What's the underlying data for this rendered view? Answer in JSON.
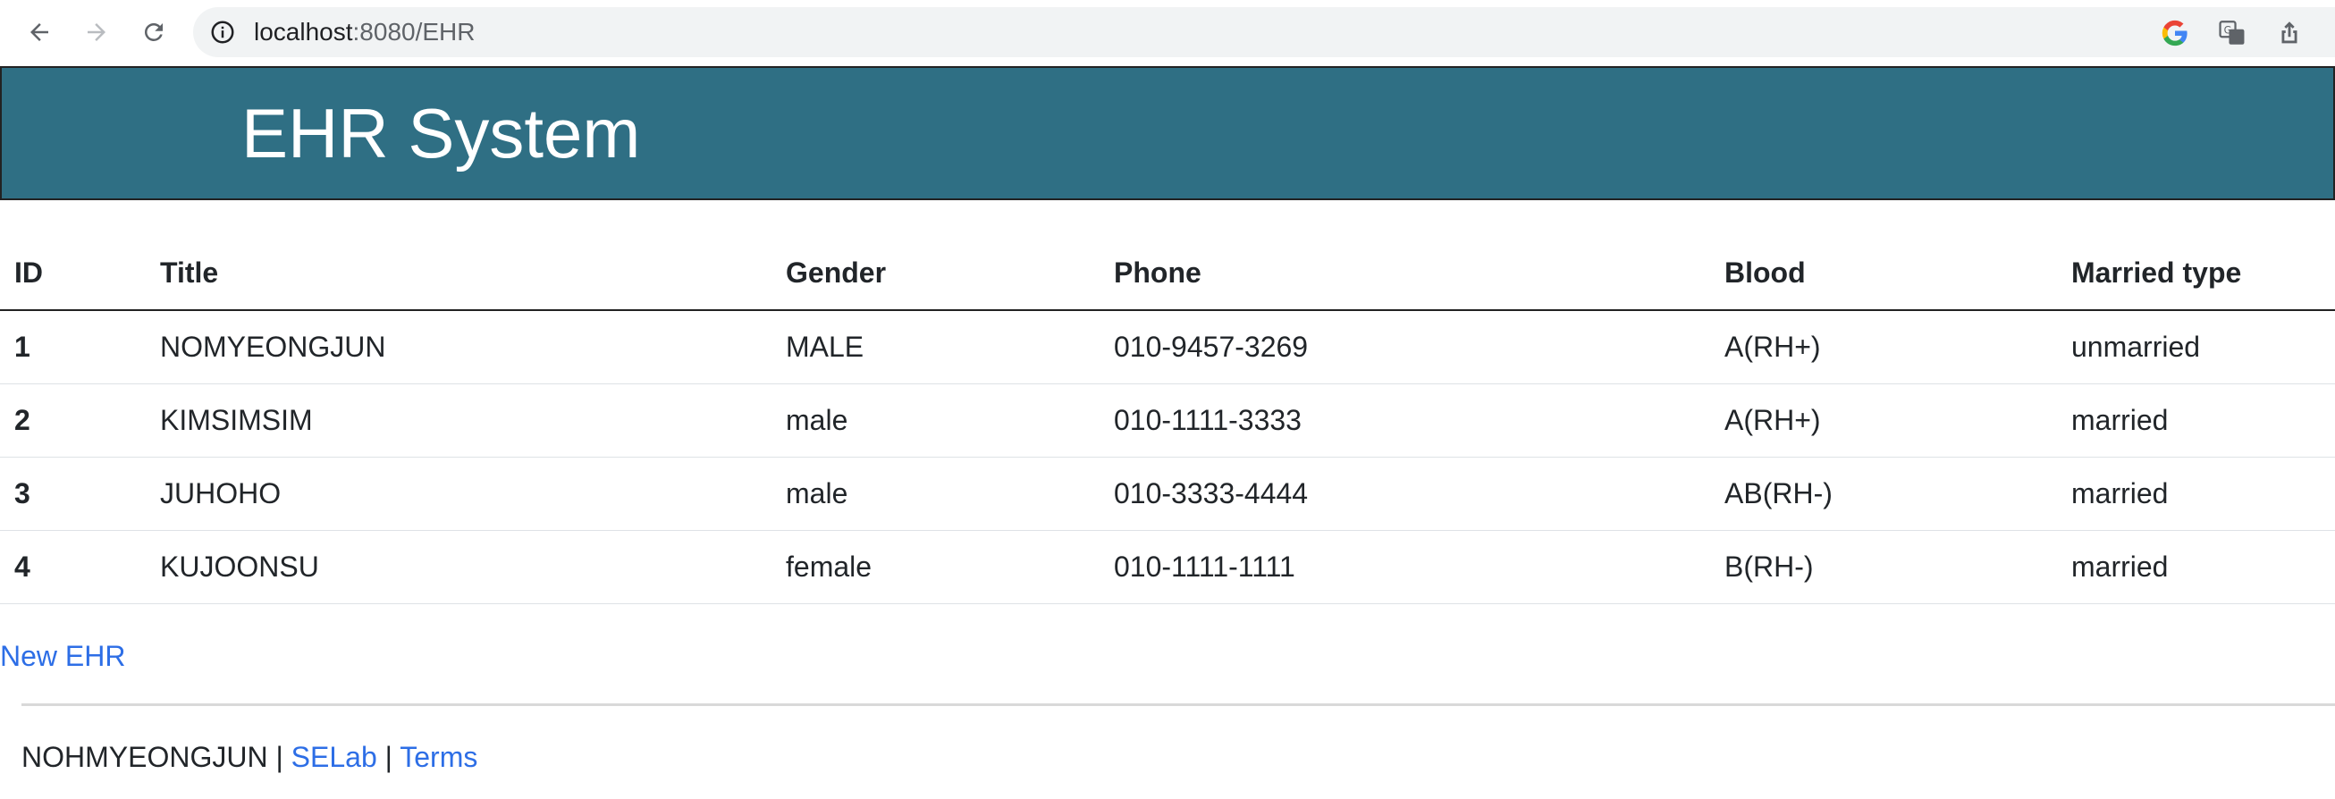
{
  "browser": {
    "url_host": "localhost",
    "url_path": ":8080/EHR"
  },
  "header": {
    "title": "EHR System"
  },
  "table": {
    "columns": [
      "ID",
      "Title",
      "Gender",
      "Phone",
      "Blood",
      "Married type"
    ],
    "rows": [
      {
        "id": "1",
        "title": "NOMYEONGJUN",
        "gender": "MALE",
        "phone": "010-9457-3269",
        "blood": "A(RH+)",
        "married": "unmarried"
      },
      {
        "id": "2",
        "title": "KIMSIMSIM",
        "gender": "male",
        "phone": "010-1111-3333",
        "blood": "A(RH+)",
        "married": "married"
      },
      {
        "id": "3",
        "title": "JUHOHO",
        "gender": "male",
        "phone": "010-3333-4444",
        "blood": "AB(RH-)",
        "married": "married"
      },
      {
        "id": "4",
        "title": "KUJOONSU",
        "gender": "female",
        "phone": "010-1111-1111",
        "blood": "B(RH-)",
        "married": "married"
      }
    ]
  },
  "actions": {
    "new_ehr": "New EHR"
  },
  "footer": {
    "author": "NOHMYEONGJUN",
    "separator": "|",
    "selab": "SELab",
    "terms": "Terms"
  },
  "colors": {
    "header_bg": "#2f6f84",
    "link": "#2d6ee6"
  }
}
